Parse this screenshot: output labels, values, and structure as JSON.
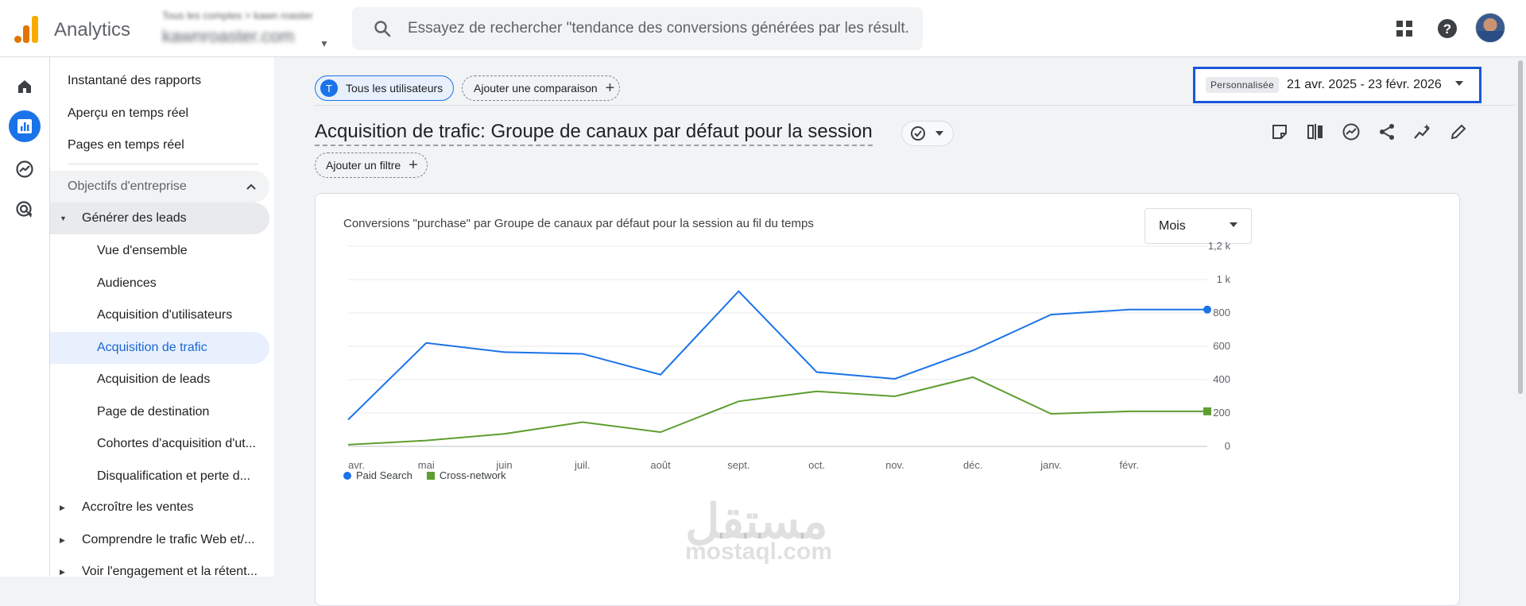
{
  "app": {
    "title": "Analytics"
  },
  "account": {
    "path": "Tous les comptes > kawn roaster",
    "name": "kawnroaster.com"
  },
  "search": {
    "placeholder": "Essayez de rechercher \"tendance des conversions générées par les résult..."
  },
  "nav": {
    "items": [
      {
        "label": "Instantané des rapports"
      },
      {
        "label": "Aperçu en temps réel"
      },
      {
        "label": "Pages en temps réel"
      }
    ],
    "section": "Objectifs d'entreprise",
    "group": "Générer des leads",
    "subitems": [
      {
        "label": "Vue d'ensemble"
      },
      {
        "label": "Audiences"
      },
      {
        "label": "Acquisition d'utilisateurs"
      },
      {
        "label": "Acquisition de trafic"
      },
      {
        "label": "Acquisition de leads"
      },
      {
        "label": "Page de destination"
      },
      {
        "label": "Cohortes d'acquisition d'ut..."
      },
      {
        "label": "Disqualification et perte d..."
      }
    ],
    "groups": [
      {
        "label": "Accroître les ventes"
      },
      {
        "label": "Comprendre le trafic Web et/..."
      },
      {
        "label": "Voir l'engagement et la rétent..."
      }
    ]
  },
  "filters": {
    "segment_badge": "T",
    "segment": "Tous les utilisateurs",
    "compare": "Ajouter une comparaison",
    "add_filter": "Ajouter un filtre"
  },
  "date": {
    "label": "Personnalisée",
    "range": "21 avr. 2025 - 23 févr. 2026"
  },
  "report": {
    "title": "Acquisition de trafic: Groupe de canaux par défaut pour la session"
  },
  "card": {
    "title": "Conversions \"purchase\" par Groupe de canaux par défaut pour la session au fil du temps",
    "period": "Mois"
  },
  "chart_data": {
    "type": "line",
    "x": [
      "avr.",
      "mai",
      "juin",
      "juil.",
      "août",
      "sept.",
      "oct.",
      "nov.",
      "déc.",
      "janv.",
      "févr."
    ],
    "y_ticks": [
      "0",
      "200",
      "400",
      "600",
      "800",
      "1 k",
      "1,2 k"
    ],
    "ylim": [
      0,
      1200
    ],
    "series": [
      {
        "name": "Paid Search",
        "color": "#1a73e8",
        "values": [
          160,
          620,
          565,
          555,
          430,
          930,
          445,
          405,
          575,
          790,
          820,
          820
        ]
      },
      {
        "name": "Cross-network",
        "color": "#5e9e30",
        "values": [
          10,
          35,
          75,
          145,
          85,
          270,
          330,
          300,
          415,
          195,
          210,
          210
        ]
      }
    ]
  },
  "watermark": {
    "arabic": "مستقل",
    "latin": "mostaql.com"
  }
}
